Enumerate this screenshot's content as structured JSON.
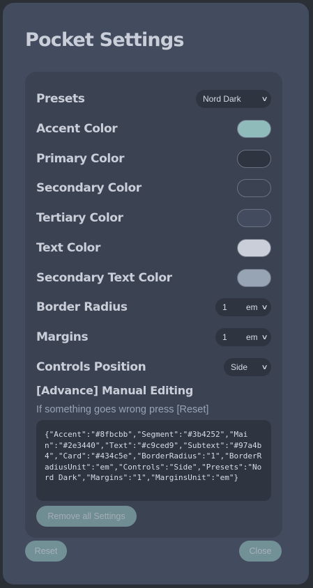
{
  "title": "Pocket Settings",
  "presets": {
    "label": "Presets",
    "value": "Nord Dark"
  },
  "colors": [
    {
      "label": "Accent Color",
      "color": "#8fbcbb"
    },
    {
      "label": "Primary Color",
      "color": "#2e3440"
    },
    {
      "label": "Secondary Color",
      "color": "#3b4252"
    },
    {
      "label": "Tertiary Color",
      "color": "#434c5e"
    },
    {
      "label": "Text Color",
      "color": "#c9ced9"
    },
    {
      "label": "Secondary Text Color",
      "color": "#97a4b4"
    }
  ],
  "border_radius": {
    "label": "Border Radius",
    "value": "1",
    "unit": "em"
  },
  "margins": {
    "label": "Margins",
    "value": "1",
    "unit": "em"
  },
  "controls_position": {
    "label": "Controls Position",
    "value": "Side"
  },
  "advanced": {
    "title": "[Advance] Manual Editing",
    "hint": "If something goes wrong press [Reset]",
    "json_text": "{\"Accent\":\"#8fbcbb\",\"Segment\":\"#3b4252\",\"Main\":\"#2e3440\",\"Text\":\"#c9ced9\",\"Subtext\":\"#97a4b4\",\"Card\":\"#434c5e\",\"BorderRadius\":\"1\",\"BorderRadiusUnit\":\"em\",\"Controls\":\"Side\",\"Presets\":\"Nord Dark\",\"Margins\":\"1\",\"MarginsUnit\":\"em\"}",
    "remove_label": "Remove all Settings"
  },
  "footer": {
    "reset_label": "Reset",
    "close_label": "Close"
  }
}
